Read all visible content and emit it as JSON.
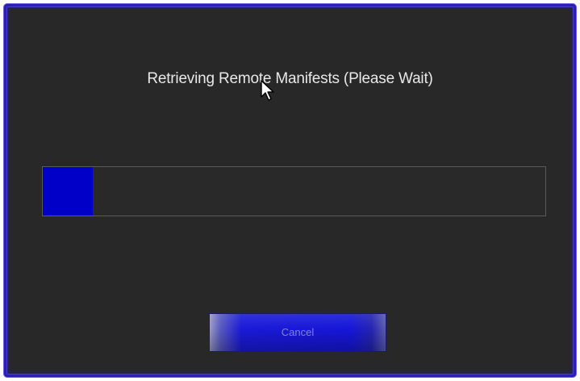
{
  "dialog": {
    "title": "Retrieving Remote Manifests (Please Wait)",
    "progress": {
      "fraction": 0.1
    },
    "cancel_label": "Cancel"
  },
  "colors": {
    "background": "#282828",
    "border": "#2a1fb0",
    "progress_fill": "#0000c8",
    "button": "#1616d8"
  },
  "icons": {
    "cursor": "mouse-pointer-icon"
  }
}
